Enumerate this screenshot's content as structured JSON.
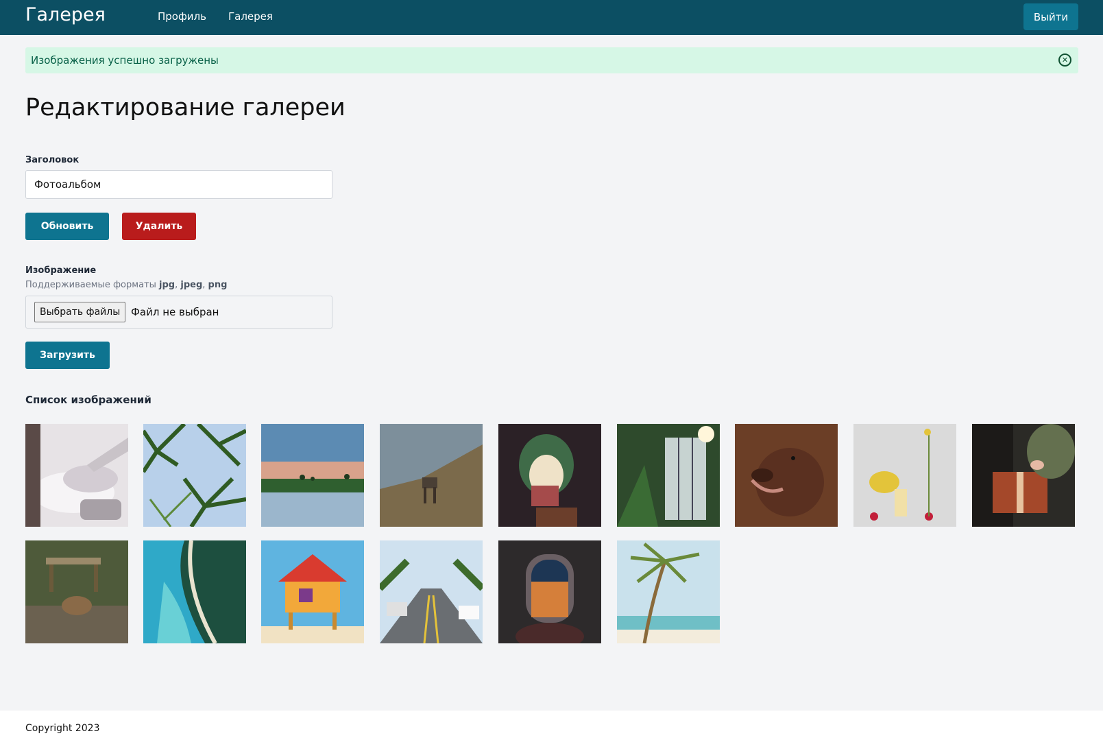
{
  "nav": {
    "brand": "Галерея",
    "links": [
      "Профиль",
      "Галерея"
    ],
    "logout_label": "Выйти"
  },
  "alert": {
    "message": "Изображения успешно загружены",
    "close_icon": "circle-x-icon"
  },
  "page": {
    "title": "Редактирование галереи"
  },
  "form": {
    "title_label": "Заголовок",
    "title_value": "Фотоальбом",
    "update_label": "Обновить",
    "delete_label": "Удалить",
    "image_label": "Изображение",
    "formats_prefix": "Поддерживаемые форматы",
    "formats": [
      "jpg",
      "jpeg",
      "png"
    ],
    "choose_files_label": "Выбрать файлы",
    "no_file_label": "Файл не выбран",
    "upload_label": "Загрузить"
  },
  "gallery": {
    "title": "Список изображений",
    "images": [
      {
        "subject": "airplane wing above clouds"
      },
      {
        "subject": "palm trees against blue sky"
      },
      {
        "subject": "sunset over water with palms"
      },
      {
        "subject": "deer on a hillside"
      },
      {
        "subject": "cauliflower still life"
      },
      {
        "subject": "greenhouse plants"
      },
      {
        "subject": "brown dog portrait"
      },
      {
        "subject": "flowers still life"
      },
      {
        "subject": "wrapping a gift"
      },
      {
        "subject": "cat near a park bench"
      },
      {
        "subject": "aerial view of a coastline"
      },
      {
        "subject": "colorful lifeguard tower"
      },
      {
        "subject": "palm-lined street"
      },
      {
        "subject": "city through airplane window"
      },
      {
        "subject": "palm tree on a beach"
      }
    ]
  },
  "footer": {
    "copyright": "Copyright 2023"
  },
  "colors": {
    "navbar": "#0c4f63",
    "primary": "#0e7490",
    "danger": "#b91c1c",
    "alert_bg": "#d6f7e6",
    "alert_text": "#065f46"
  }
}
